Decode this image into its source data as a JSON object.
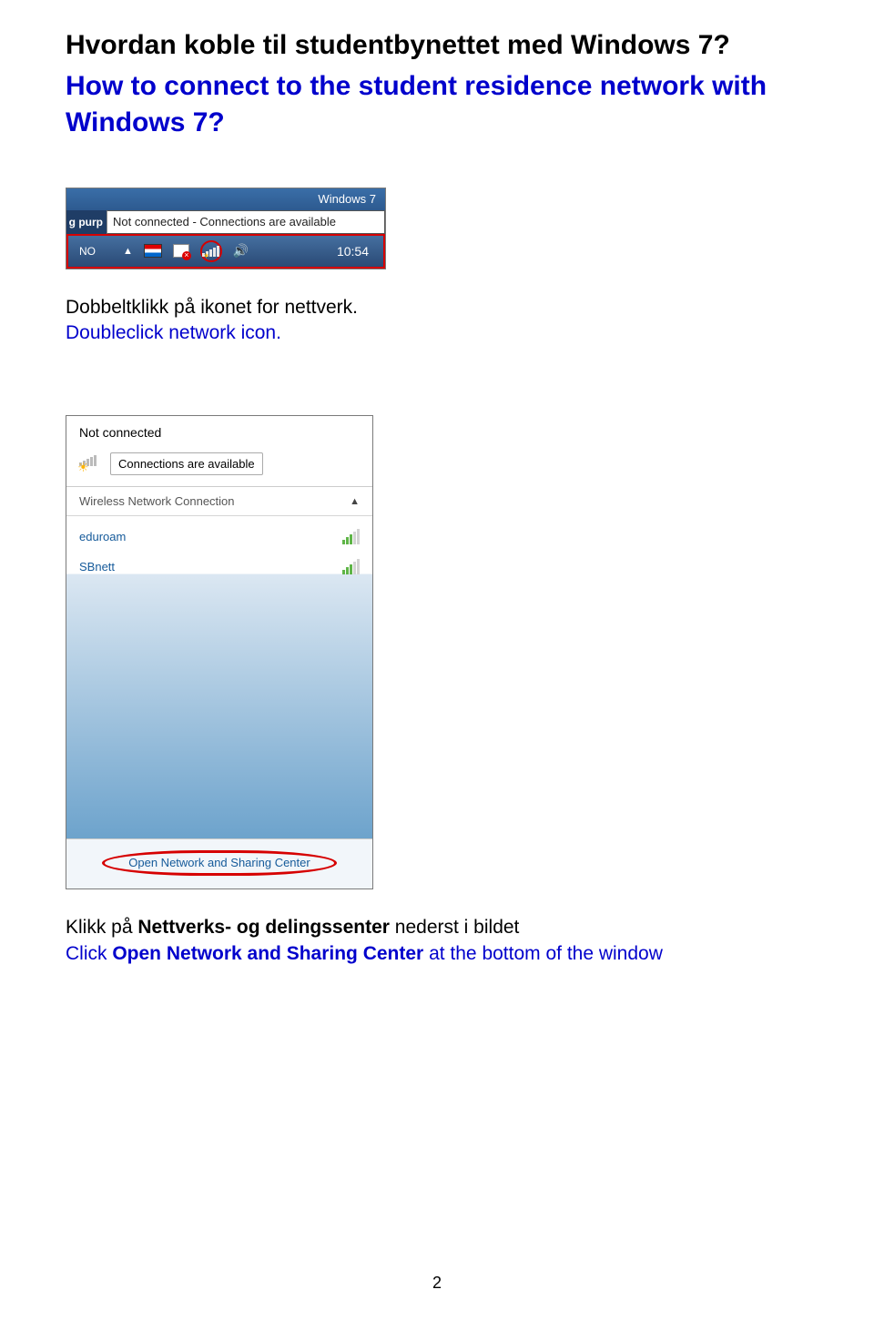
{
  "title_no": "Hvordan koble til studentbynettet med Windows 7?",
  "title_en": "How to connect to the student residence network with Windows 7?",
  "taskbar": {
    "window_title": "Windows 7",
    "left_label": "g purp",
    "tooltip": "Not connected - Connections are available",
    "lang": "NO",
    "time": "10:54"
  },
  "caption1_no": "Dobbeltklikk på ikonet for nettverk.",
  "caption1_en": "Doubleclick network icon.",
  "flyout": {
    "status": "Not connected",
    "available": "Connections are available",
    "section": "Wireless Network Connection",
    "networks": [
      {
        "name": "eduroam"
      },
      {
        "name": "SBnett"
      }
    ],
    "footer_link": "Open Network and Sharing Center"
  },
  "caption2_no_pre": "Klikk på ",
  "caption2_no_bold": "Nettverks- og delingssenter",
  "caption2_no_post": " nederst i bildet",
  "caption2_en_pre": "Click ",
  "caption2_en_bold": "Open Network and Sharing Center",
  "caption2_en_post": " at the bottom of the window",
  "page_number": "2"
}
